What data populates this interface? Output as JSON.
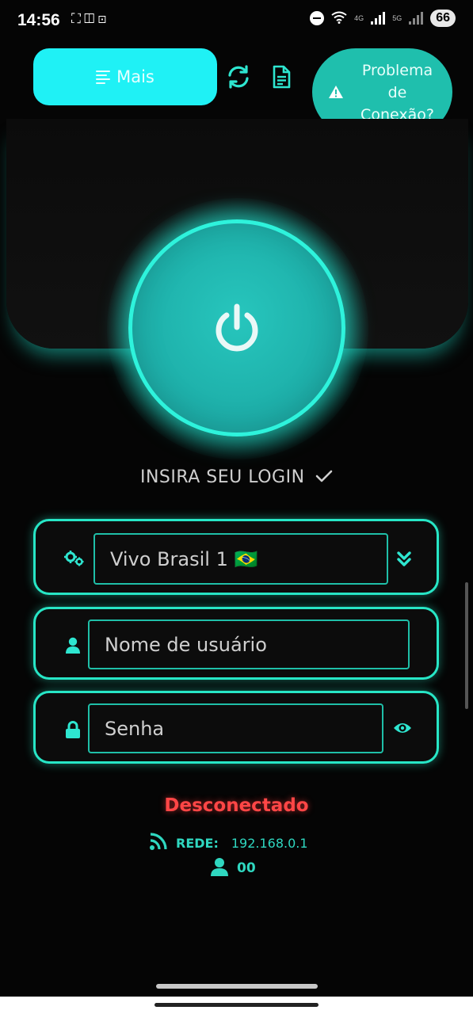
{
  "status_bar": {
    "time": "14:56",
    "left_icons": [
      "fullscreen-icon",
      "notification-icon",
      "screen-record-icon"
    ],
    "network_label_1": "4G",
    "network_label_2": "5G",
    "battery": "66"
  },
  "toolbar": {
    "mais_label": "Mais",
    "problema_label": "Problema\nde\nConexão?"
  },
  "login_label": "INSIRA SEU LOGIN",
  "fields": {
    "server_value": "Vivo Brasil 1 🇧🇷",
    "username_placeholder": "Nome de usuário",
    "password_placeholder": "Senha"
  },
  "connection": {
    "status": "Desconectado",
    "rede_label": "REDE:",
    "rede_value": "192.168.0.1",
    "users_value": "00"
  },
  "colors": {
    "accent_cyan": "#1ff1f5",
    "accent_teal": "#27e6c6",
    "status_red": "#ff4646"
  }
}
